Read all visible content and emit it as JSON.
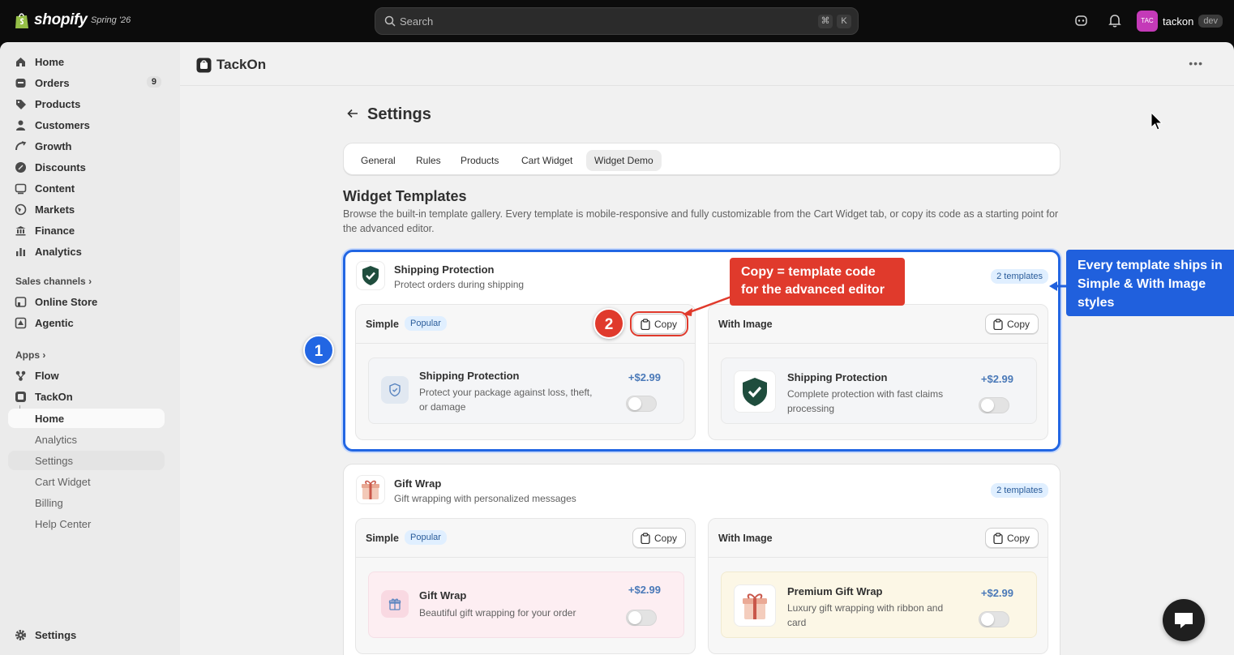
{
  "topbar": {
    "logo_text": "shopify",
    "version": "Spring '26",
    "search_placeholder": "Search",
    "shortcut_cmd": "⌘",
    "shortcut_key": "K",
    "account_initials": "TAC",
    "account_name": "tackon",
    "account_badge": "dev"
  },
  "sidebar": {
    "main_items": [
      {
        "label": "Home",
        "icon": "home-icon"
      },
      {
        "label": "Orders",
        "icon": "orders-icon",
        "count": "9"
      },
      {
        "label": "Products",
        "icon": "tag-icon"
      },
      {
        "label": "Customers",
        "icon": "person-icon"
      },
      {
        "label": "Growth",
        "icon": "growth-icon"
      },
      {
        "label": "Discounts",
        "icon": "discount-icon"
      },
      {
        "label": "Content",
        "icon": "content-icon"
      },
      {
        "label": "Markets",
        "icon": "globe-icon"
      },
      {
        "label": "Finance",
        "icon": "bank-icon"
      },
      {
        "label": "Analytics",
        "icon": "bar-chart-icon"
      }
    ],
    "sales_channels_label": "Sales channels",
    "channels": [
      {
        "label": "Online Store",
        "icon": "store-icon"
      },
      {
        "label": "Agentic",
        "icon": "agentic-icon"
      }
    ],
    "apps_label": "Apps",
    "apps": [
      {
        "label": "Flow",
        "icon": "flow-icon"
      },
      {
        "label": "TackOn",
        "icon": "tackon-icon"
      }
    ],
    "app_subitems": [
      "Home",
      "Analytics",
      "Settings",
      "Cart Widget",
      "Billing",
      "Help Center"
    ],
    "settings_label": "Settings"
  },
  "app": {
    "title": "TackOn",
    "page_title": "Settings",
    "tabs": [
      "General",
      "Rules",
      "Products",
      "Cart Widget",
      "Widget Demo"
    ],
    "active_tab": "Widget Demo",
    "section_title": "Widget Templates",
    "section_desc": "Browse the built-in template gallery. Every template is mobile-responsive and fully customizable from the Cart Widget tab, or copy its code as a starting point for the advanced editor."
  },
  "templates": [
    {
      "title": "Shipping Protection",
      "subtitle": "Protect orders during shipping",
      "count_label": "2 templates",
      "simple": {
        "name": "Simple",
        "badge": "Popular",
        "copy_label": "Copy",
        "preview_title": "Shipping Protection",
        "preview_desc": "Protect your package against loss, theft, or damage",
        "price": "+$2.99",
        "enabled": false
      },
      "with_image": {
        "name": "With Image",
        "copy_label": "Copy",
        "preview_title": "Shipping Protection",
        "preview_desc": "Complete protection with fast claims processing",
        "price": "+$2.99",
        "enabled": false
      }
    },
    {
      "title": "Gift Wrap",
      "subtitle": "Gift wrapping with personalized messages",
      "count_label": "2 templates",
      "simple": {
        "name": "Simple",
        "badge": "Popular",
        "copy_label": "Copy",
        "preview_title": "Gift Wrap",
        "preview_desc": "Beautiful gift wrapping for your order",
        "price": "+$2.99",
        "enabled": false
      },
      "with_image": {
        "name": "With Image",
        "copy_label": "Copy",
        "preview_title": "Premium Gift Wrap",
        "preview_desc": "Luxury gift wrapping with ribbon and card",
        "price": "+$2.99",
        "enabled": false
      }
    }
  ],
  "annotations": {
    "step1": "1",
    "step2": "2",
    "callout_copy_line1": "Copy = template code",
    "callout_copy_line2": "for the advanced editor",
    "callout_styles": "Every template ships in Simple & With Image styles"
  },
  "colors": {
    "accent_blue": "#2266e3",
    "callout_red": "#e03a2c",
    "price_blue": "#4a79b8",
    "shield_green": "#1f4d3d"
  }
}
